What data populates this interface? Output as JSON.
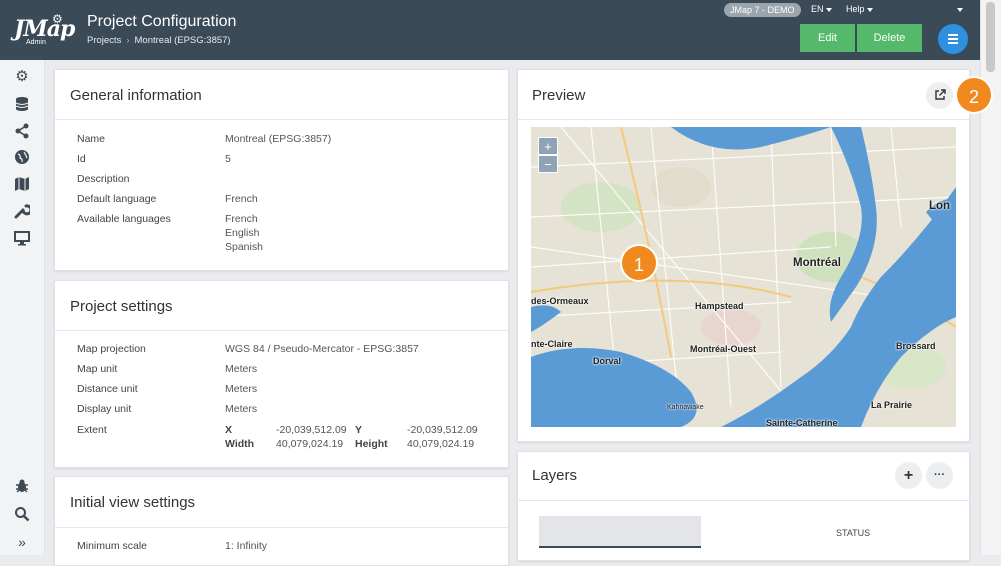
{
  "header": {
    "title": "Project Configuration",
    "breadcrumb": [
      "Projects",
      "Montreal (EPSG:3857)"
    ],
    "env_badge": "JMap 7 - DEMO",
    "lang_menu": "EN",
    "help_menu": "Help",
    "edit_label": "Edit",
    "delete_label": "Delete",
    "logo_text": "JMap",
    "logo_sub": "Admin"
  },
  "sidebar": {
    "icons": [
      "gears-icon",
      "database-icon",
      "share-icon",
      "globe-icon",
      "map-icon",
      "wrench-icon",
      "monitor-icon",
      "bug-icon",
      "search-icon",
      "expand-icon"
    ]
  },
  "general": {
    "title": "General information",
    "rows": [
      {
        "label": "Name",
        "value": "Montreal (EPSG:3857)"
      },
      {
        "label": "Id",
        "value": "5"
      },
      {
        "label": "Description",
        "value": ""
      },
      {
        "label": "Default language",
        "value": "French"
      },
      {
        "label": "Available languages",
        "values": [
          "French",
          "English",
          "Spanish"
        ]
      }
    ]
  },
  "settings": {
    "title": "Project settings",
    "rows": [
      {
        "label": "Map projection",
        "value": "WGS 84 / Pseudo-Mercator - EPSG:3857"
      },
      {
        "label": "Map unit",
        "value": "Meters"
      },
      {
        "label": "Distance unit",
        "value": "Meters"
      },
      {
        "label": "Display unit",
        "value": "Meters"
      }
    ],
    "extent": {
      "label": "Extent",
      "x_label": "X",
      "x": "-20,039,512.09",
      "y_label": "Y",
      "y": "-20,039,512.09",
      "width_label": "Width",
      "width": "40,079,024.19",
      "height_label": "Height",
      "height": "40,079,024.19"
    }
  },
  "initial_view": {
    "title": "Initial view settings",
    "rows": [
      {
        "label": "Minimum scale",
        "value": "1: Infinity"
      }
    ]
  },
  "preview": {
    "title": "Preview",
    "badge_map": "1",
    "badge_open": "2",
    "zoom_in": "+",
    "zoom_out": "−",
    "labels": [
      "Montréal",
      "Lon",
      "des-Ormeaux",
      "Hampstead",
      "nte-Claire",
      "Dorval",
      "Montréal-Ouest",
      "Brossard",
      "La Prairie",
      "Kahnawake",
      "Sainte-Catherine"
    ]
  },
  "layers": {
    "title": "Layers",
    "status_header": "STATUS",
    "add_label": "+",
    "more_label": "···"
  },
  "colors": {
    "header": "#3b4a57",
    "accent_green": "#54b96a",
    "accent_blue": "#2f8fe0",
    "badge_orange": "#f18a1e",
    "water": "#5b9bd5"
  }
}
